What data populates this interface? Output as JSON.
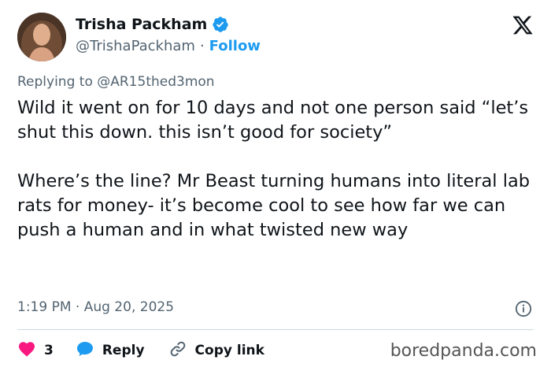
{
  "author": {
    "display_name": "Trisha Packham",
    "handle": "@TrishaPackham",
    "separator": "·",
    "follow_label": "Follow",
    "verified": true
  },
  "reply_to": "Replying to @AR15thed3mon",
  "tweet": {
    "text": "Wild it went on for 10 days and not one person said “let’s shut this down. this isn’t good for society”\n\nWhere’s the line? Mr Beast turning humans into literal lab rats for money- it’s become cool to see how far we can push a human and in what twisted new way",
    "timestamp": "1:19 PM · Aug 20, 2025"
  },
  "actions": {
    "like_count": "3",
    "reply_label": "Reply",
    "copy_link_label": "Copy link"
  },
  "watermark": "boredpanda.com",
  "colors": {
    "accent": "#1d9bf0",
    "like": "#f91880",
    "secondary_text": "#536471",
    "divider": "#cfd9de"
  },
  "icons": [
    "avatar",
    "verified-badge-icon",
    "x-logo-icon",
    "info-icon",
    "heart-icon",
    "reply-bubble-icon",
    "link-icon"
  ]
}
